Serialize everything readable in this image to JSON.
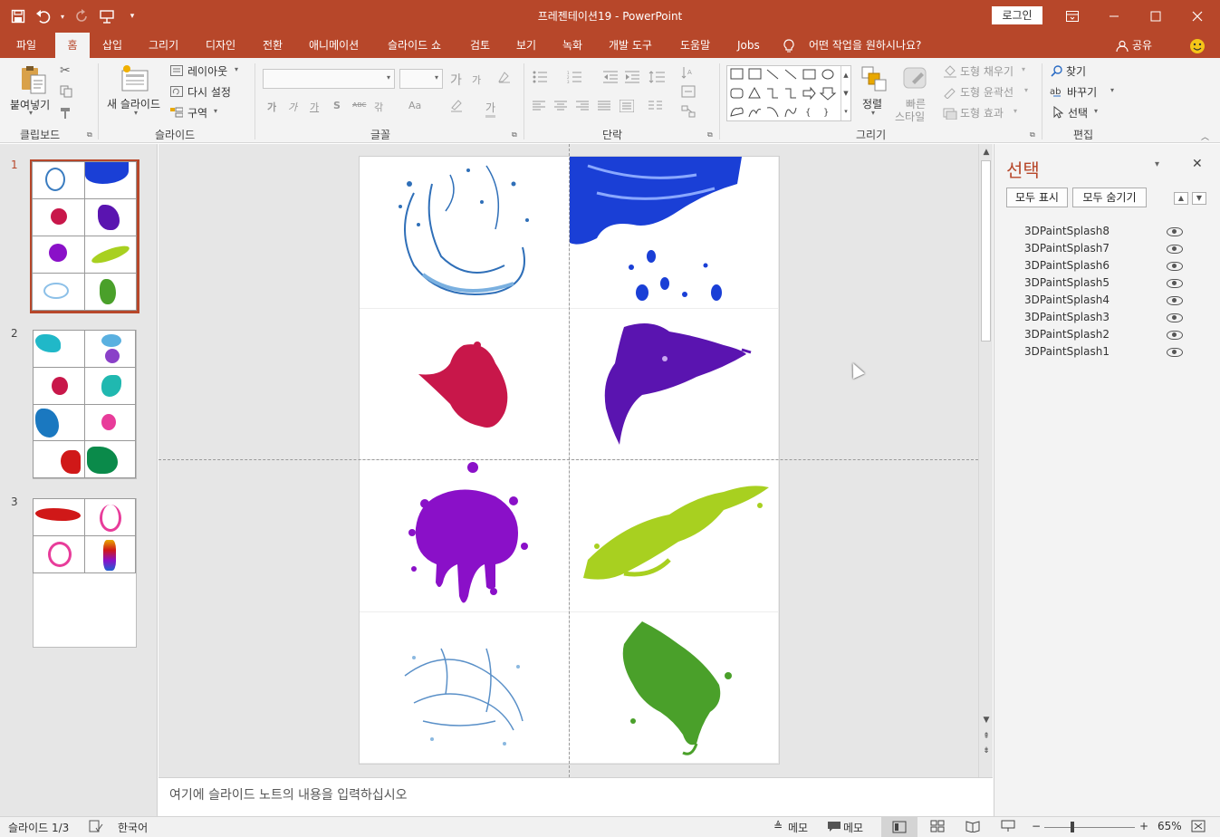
{
  "window": {
    "title": "프레젠테이션19  -  PowerPoint",
    "login": "로그인"
  },
  "tabs": [
    {
      "label": "파일"
    },
    {
      "label": "홈"
    },
    {
      "label": "삽입"
    },
    {
      "label": "그리기"
    },
    {
      "label": "디자인"
    },
    {
      "label": "전환"
    },
    {
      "label": "애니메이션"
    },
    {
      "label": "슬라이드 쇼"
    },
    {
      "label": "검토"
    },
    {
      "label": "보기"
    },
    {
      "label": "녹화"
    },
    {
      "label": "개발 도구"
    },
    {
      "label": "도움말"
    },
    {
      "label": "Jobs"
    }
  ],
  "tell_me": "어떤 작업을 원하시나요?",
  "share": "공유",
  "ribbon": {
    "clipboard": {
      "label": "클립보드",
      "paste": "붙여넣기"
    },
    "slides": {
      "label": "슬라이드",
      "new_slide": "새 슬라이드",
      "layout": "레이아웃",
      "reset": "다시 설정",
      "section": "구역"
    },
    "font": {
      "label": "글꼴",
      "bold": "가",
      "italic": "가",
      "underline": "가",
      "strike": "S",
      "abc": "ᴀʙᴄ",
      "spacing": "갂",
      "case": "Aa",
      "grow": "가",
      "shrink": "가",
      "color": "가"
    },
    "paragraph": {
      "label": "단락"
    },
    "drawing": {
      "label": "그리기",
      "arrange": "정렬",
      "quick_style_1": "빠른",
      "quick_style_2": "스타일",
      "fill": "도형 채우기",
      "outline": "도형 윤곽선",
      "effects": "도형 효과"
    },
    "editing": {
      "label": "편집",
      "find": "찾기",
      "replace": "바꾸기",
      "select": "선택"
    }
  },
  "slides_panel": {
    "numbers": [
      "1",
      "2",
      "3"
    ]
  },
  "notes_placeholder": "여기에 슬라이드 노트의 내용을 입력하십시오",
  "selection_pane": {
    "title": "선택",
    "show_all": "모두 표시",
    "hide_all": "모두 숨기기",
    "items": [
      "3DPaintSplash8",
      "3DPaintSplash7",
      "3DPaintSplash6",
      "3DPaintSplash5",
      "3DPaintSplash4",
      "3DPaintSplash3",
      "3DPaintSplash2",
      "3DPaintSplash1"
    ]
  },
  "status": {
    "slide": "슬라이드 1/3",
    "language": "한국어",
    "notes": "메모",
    "comments": "메모",
    "zoom": "65%"
  },
  "colors": {
    "accent": "#b7472a",
    "water": "#3a7cc0",
    "blue": "#1a3fd6",
    "crimson": "#c8174a",
    "indigo": "#5a14b0",
    "violet": "#8a10c8",
    "lime": "#a8d020",
    "green": "#4aa02a",
    "cyan": "#20b8c8",
    "pink": "#e83c9a",
    "red": "#d01818"
  }
}
